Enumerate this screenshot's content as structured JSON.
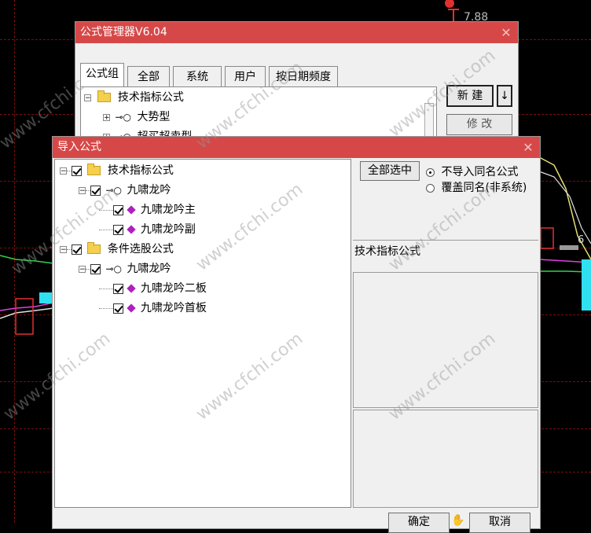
{
  "background_price_label": "7.88",
  "watermark_text": "www.cfchi.com",
  "manager_window": {
    "title": "公式管理器V6.04",
    "tabs": [
      "公式组",
      "全部",
      "系统",
      "用户",
      "按日期频度"
    ],
    "active_tab": "公式组",
    "tree": [
      {
        "label": "技术指标公式",
        "expand": "⊟"
      },
      {
        "label": "大势型",
        "expand": "⊞"
      },
      {
        "label": "超买超卖型",
        "expand": "⊞"
      }
    ],
    "new_button": "新 建",
    "arrow_button": "↓",
    "edit_button": "修 改"
  },
  "import_dialog": {
    "title": "导入公式",
    "select_all_button": "全部选中",
    "radio_options": [
      {
        "label": "不导入同名公式",
        "checked": true
      },
      {
        "label": "覆盖同名(非系统)",
        "checked": false
      }
    ],
    "info_label": "技术指标公式",
    "tree": [
      {
        "label": "技术指标公式",
        "type": "folder",
        "checked": true
      },
      {
        "label": "九啸龙吟",
        "type": "group",
        "checked": true
      },
      {
        "label": "九啸龙吟主",
        "type": "formula",
        "checked": true
      },
      {
        "label": "九啸龙吟副",
        "type": "formula",
        "checked": true
      },
      {
        "label": "条件选股公式",
        "type": "folder",
        "checked": true
      },
      {
        "label": "九啸龙吟",
        "type": "group",
        "checked": true
      },
      {
        "label": "九啸龙吟二板",
        "type": "formula",
        "checked": true
      },
      {
        "label": "九啸龙吟首板",
        "type": "formula",
        "checked": true
      }
    ],
    "ok_button": "确定",
    "cancel_button": "取消"
  },
  "colors": {
    "title_bar": "#d64848",
    "dialog_bg": "#f0f0f0",
    "chart_bg": "#000000",
    "grid": "#7a0e0e"
  }
}
